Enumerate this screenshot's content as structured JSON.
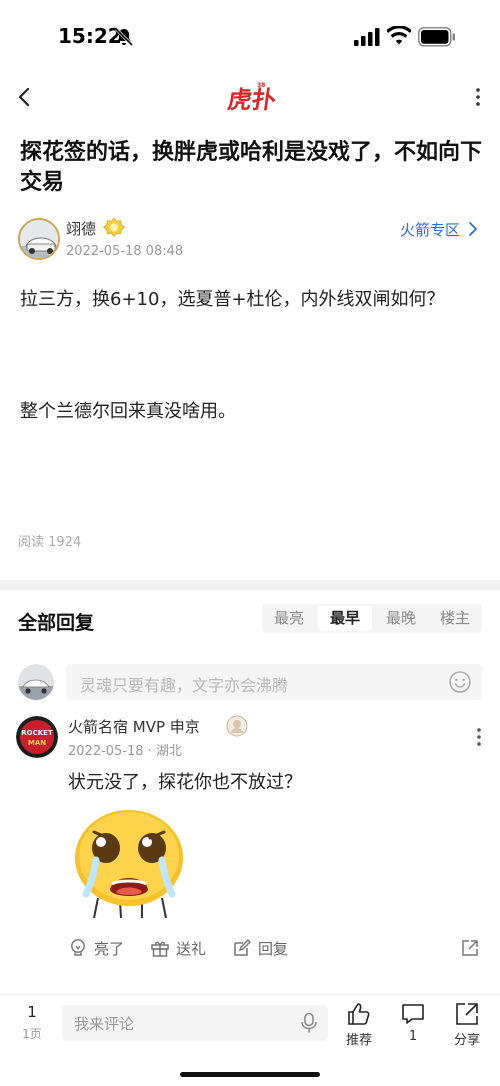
{
  "status_bar": {
    "time": "15:22",
    "icons": [
      "bell-mute-icon",
      "signal-icon",
      "wifi-icon",
      "battery-icon"
    ]
  },
  "nav": {
    "back_icon": "chevron-left-icon",
    "logo_text": "虎扑",
    "more_icon": "vertical-dots-icon"
  },
  "post": {
    "title": "探花签的话，换胖虎或哈利是没戏了，不如向下交易",
    "author": {
      "name": "翊德",
      "time": "2022-05-18 08:48"
    },
    "zone_link": "火箭专区",
    "body": [
      "拉三方，换6+10，选夏普+杜伦，内外线双闸如何？",
      "整个兰德尔回来真没啥用。"
    ],
    "read_count": "阅读 1924"
  },
  "replies": {
    "header": "全部回复",
    "sort_tabs": [
      "最亮",
      "最早",
      "最晚",
      "楼主"
    ],
    "active_tab": "最早",
    "input_placeholder": "灵魂只要有趣，文字亦会沸腾",
    "items": [
      {
        "name": "火箭名宿 MVP 申京",
        "meta": "2022-05-18 · 湖北",
        "text": "状元没了，探花你也不放过？",
        "sticker": "crying-face-sticker",
        "actions": {
          "light": "亮了",
          "gift": "送礼",
          "reply": "回复"
        }
      }
    ]
  },
  "bottom_bar": {
    "page_num": "1",
    "page_label": "1页",
    "input_placeholder": "我来评论",
    "recommend_label": "推荐",
    "comment_count": "1",
    "share_label": "分享"
  },
  "colors": {
    "accent_blue": "#2a6fd6",
    "brand_red": "#d8262a",
    "muted_gray": "#999999"
  }
}
